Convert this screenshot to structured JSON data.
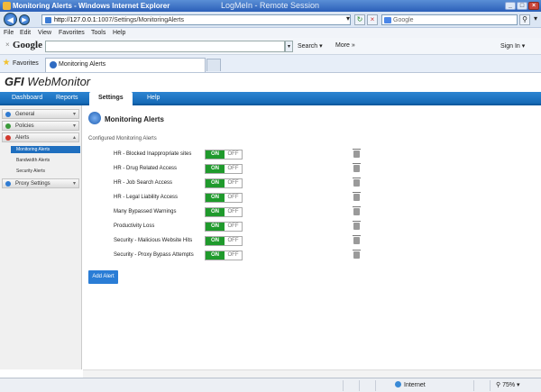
{
  "window": {
    "title": "Monitoring Alerts - Windows Internet Explorer",
    "overlay": "LogMeIn - Remote Session"
  },
  "address": {
    "url_host": "http://127.0.0.1",
    "url_rest": ":1007/Settings/MonitoringAlerts"
  },
  "search": {
    "placeholder": "Google"
  },
  "menu": {
    "file": "File",
    "edit": "Edit",
    "view": "View",
    "favorites": "Favorites",
    "tools": "Tools",
    "help": "Help"
  },
  "google_bar": {
    "logo": "Google",
    "search_label": "Search",
    "more_label": "More",
    "signin_label": "Sign In"
  },
  "favbar": {
    "favorites_label": "Favorites",
    "tab_label": "Monitoring Alerts"
  },
  "app": {
    "logo_gfi": "GFI",
    "logo_product": "WebMonitor"
  },
  "tabs": [
    "Dashboard",
    "Reports",
    "Settings",
    "Help"
  ],
  "sidebar": {
    "general": "General",
    "policies": "Policies",
    "alerts": "Alerts",
    "alert_items": [
      "Monitoring Alerts",
      "Bandwidth Alerts",
      "Security Alerts"
    ],
    "proxy": "Proxy Settings"
  },
  "page": {
    "title": "Monitoring Alerts",
    "section": "Configured Monitoring Alerts",
    "add_button": "Add Alert"
  },
  "toggle": {
    "on": "ON",
    "off": "OFF"
  },
  "alerts": [
    {
      "name": "HR - Blocked Inappropriate sites",
      "enabled": true
    },
    {
      "name": "HR - Drug Related Access",
      "enabled": true
    },
    {
      "name": "HR - Job Search Access",
      "enabled": true
    },
    {
      "name": "HR - Legal Liability Access",
      "enabled": true
    },
    {
      "name": "Many Bypassed Warnings",
      "enabled": true
    },
    {
      "name": "Productivity Loss",
      "enabled": true
    },
    {
      "name": "Security - Malicious Website Hits",
      "enabled": true
    },
    {
      "name": "Security - Proxy Bypass Attempts",
      "enabled": true
    }
  ],
  "statusbar": {
    "zone": "Internet",
    "zoom": "75%"
  },
  "colors": {
    "accent": "#1f6fbf",
    "on_green": "#1f9a2c",
    "title_blue": "#2b5fb8"
  }
}
